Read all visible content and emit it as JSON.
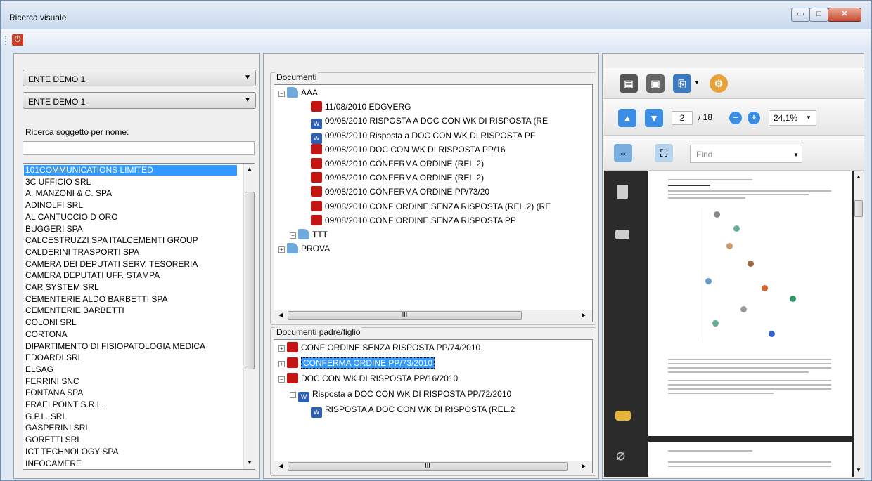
{
  "window": {
    "title": "Ricerca visuale",
    "min_icon": "minimize-icon",
    "max_icon": "maximize-icon",
    "close_icon": "close-icon",
    "min_glyph": "▭",
    "max_glyph": "□",
    "close_glyph": "✕"
  },
  "toolbar": {
    "power_icon": "power-icon",
    "power_glyph": "⏻"
  },
  "left": {
    "combo1": "ENTE DEMO 1",
    "combo2": "ENTE DEMO 1",
    "search_label": "Ricerca soggetto per nome:",
    "search_value": "",
    "items": [
      "101COMMUNICATIONS LIMITED",
      "3C UFFICIO SRL",
      "A. MANZONI & C. SPA",
      "ADINOLFI SRL",
      "AL CANTUCCIO D ORO",
      "BUGGERI SPA",
      "CALCESTRUZZI SPA ITALCEMENTI GROUP",
      "CALDERINI TRASPORTI SPA",
      "CAMERA DEI DEPUTATI          SERV. TESORERIA",
      "CAMERA DEPUTATI UFF. STAMPA",
      "CAR SYSTEM SRL",
      "CEMENTERIE ALDO BARBETTI SPA",
      "CEMENTERIE BARBETTI",
      "COLONI SRL",
      "CORTONA",
      "DIPARTIMENTO DI FISIOPATOLOGIA MEDICA",
      "EDOARDI SRL",
      "ELSAG",
      "FERRINI SNC",
      "FONTANA SPA",
      "FRAELPOINT S.R.L.",
      "G.P.L. SRL",
      "GASPERINI SRL",
      "GORETTI SRL",
      "ICT TECHNOLOGY SPA",
      "INFOCAMERE"
    ],
    "selected_index": 0
  },
  "docs": {
    "label": "Documenti",
    "nodes": [
      {
        "label": "AAA",
        "kind": "fld",
        "indent": 0,
        "exp": "−"
      },
      {
        "label": "11/08/2010 EDGVERG",
        "kind": "pdf",
        "indent": 2
      },
      {
        "label": "09/08/2010 RISPOSTA A DOC CON WK DI RISPOSTA (RE",
        "kind": "doc",
        "indent": 2
      },
      {
        "label": "09/08/2010 Risposta a DOC CON WK DI RISPOSTA          PF",
        "kind": "doc",
        "indent": 2
      },
      {
        "label": "09/08/2010 DOC CON WK DI RISPOSTA                    PP/16",
        "kind": "pdf",
        "indent": 2
      },
      {
        "label": "09/08/2010 CONFERMA ORDINE (REL.2)",
        "kind": "pdf",
        "indent": 2
      },
      {
        "label": "09/08/2010 CONFERMA ORDINE (REL.2)",
        "kind": "pdf",
        "indent": 2
      },
      {
        "label": "09/08/2010 CONFERMA ORDINE                              PP/73/20",
        "kind": "pdf",
        "indent": 2
      },
      {
        "label": "09/08/2010 CONF ORDINE SENZA RISPOSTA (REL.2) (RE",
        "kind": "pdf",
        "indent": 2
      },
      {
        "label": "09/08/2010 CONF ORDINE SENZA RISPOSTA                PP",
        "kind": "pdf",
        "indent": 2
      },
      {
        "label": "TTT",
        "kind": "fld",
        "indent": 1,
        "exp": "+"
      },
      {
        "label": "PROVA",
        "kind": "fld",
        "indent": 0,
        "exp": "+"
      }
    ],
    "scroll_glyph": "III"
  },
  "pf": {
    "label": "Documenti padre/figlio",
    "nodes": [
      {
        "label": "CONF ORDINE SENZA RISPOSTA            PP/74/2010",
        "kind": "pdf",
        "indent": 0,
        "exp": "+"
      },
      {
        "label": "CONFERMA ORDINE                             PP/73/2010",
        "kind": "pdf",
        "indent": 0,
        "exp": "+"
      },
      {
        "label": "DOC CON WK DI RISPOSTA                PP/16/2010",
        "kind": "pdf",
        "indent": 0,
        "exp": "−"
      },
      {
        "label": "Risposta a DOC CON WK DI RISPOSTA         PP/72/2010",
        "kind": "doc",
        "indent": 1,
        "exp": "−"
      },
      {
        "label": "RISPOSTA A DOC CON WK DI RISPOSTA (REL.2",
        "kind": "doc",
        "indent": 2
      }
    ],
    "selected": 1
  },
  "viewer": {
    "page_current": "2",
    "page_total": "/ 18",
    "zoom": "24,1%",
    "find_placeholder": "Find",
    "icons": [
      "print-icon",
      "save-icon",
      "export-icon",
      "settings-icon",
      "prev-page-icon",
      "next-page-icon",
      "zoom-out-icon",
      "zoom-in-icon",
      "fit-width-icon",
      "fit-page-icon",
      "pages-icon",
      "binoculars-icon",
      "comments-icon",
      "attachment-icon"
    ]
  },
  "colors": {
    "selection": "#3399ff",
    "pdf": "#c41515",
    "word": "#2f5fb3"
  }
}
